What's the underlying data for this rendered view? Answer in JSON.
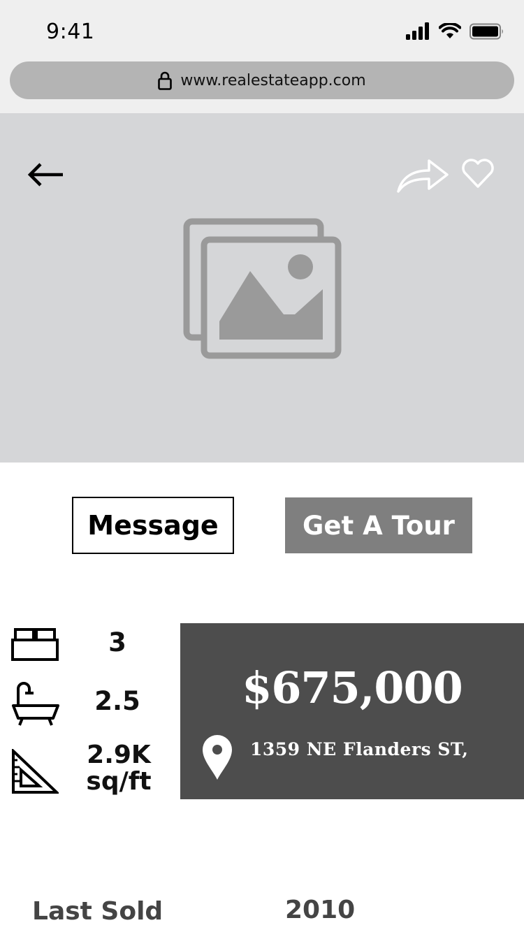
{
  "status_bar": {
    "time": "9:41",
    "url": "www.realestateapp.com",
    "icons": [
      "signal-icon",
      "wifi-icon",
      "battery-icon",
      "lock-icon"
    ]
  },
  "hero": {
    "icons": [
      "back-arrow-icon",
      "share-icon",
      "heart-icon",
      "image-placeholder-icon"
    ]
  },
  "actions": {
    "message_label": "Message",
    "tour_label": "Get A Tour"
  },
  "specs": {
    "beds": "3",
    "baths": "2.5",
    "area_value": "2.9K",
    "area_unit": "sq/ft",
    "icons": [
      "bed-icon",
      "bathtub-icon",
      "set-square-icon"
    ]
  },
  "listing": {
    "price": "$675,000",
    "address": "1359 NE Flanders ST,",
    "icon": "location-pin-icon"
  },
  "history": {
    "last_sold_label": "Last Sold",
    "last_sold_year": "2010"
  },
  "colors": {
    "status_bg": "#efefef",
    "url_bar_bg": "#b4b4b4",
    "hero_bg": "#d5d6d8",
    "tour_button_bg": "#7f7f7f",
    "price_card_bg": "#4d4d4d"
  }
}
